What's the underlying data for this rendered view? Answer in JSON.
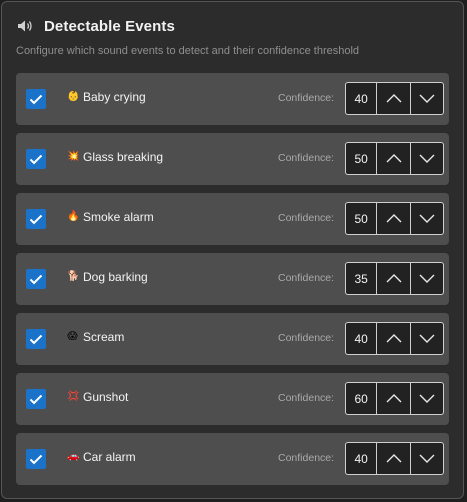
{
  "header": {
    "title": "Detectable Events",
    "subtitle": "Configure which sound events to detect and their confidence threshold",
    "icon": "speaker-icon"
  },
  "confidence_label": "Confidence:",
  "colors": {
    "checkbox": "#1a73c9",
    "row": "#4e4e4e",
    "panel": "#2c2c2c"
  },
  "events": [
    {
      "label": "Baby crying",
      "icon": "baby-icon",
      "glyph": "👶",
      "value": "40",
      "checked": true
    },
    {
      "label": "Glass breaking",
      "icon": "glass-icon",
      "glyph": "💥",
      "value": "50",
      "checked": true
    },
    {
      "label": "Smoke alarm",
      "icon": "fire-icon",
      "glyph": "🔥",
      "value": "50",
      "checked": true
    },
    {
      "label": "Dog barking",
      "icon": "dog-icon",
      "glyph": "🐕",
      "value": "35",
      "checked": true
    },
    {
      "label": "Scream",
      "icon": "scream-icon",
      "glyph": "😱",
      "value": "40",
      "checked": true
    },
    {
      "label": "Gunshot",
      "icon": "gunshot-icon",
      "glyph": "💢",
      "value": "60",
      "checked": true
    },
    {
      "label": "Car alarm",
      "icon": "car-icon",
      "glyph": "🚗",
      "value": "40",
      "checked": true
    }
  ]
}
